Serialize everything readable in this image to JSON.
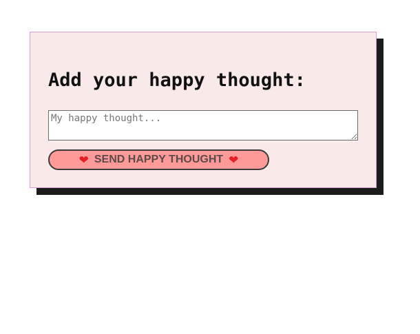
{
  "form": {
    "title": "Add your happy thought:",
    "input_placeholder": "My happy thought...",
    "input_value": "",
    "button_label": "SEND HAPPY THOUGHT",
    "button_icon": "heart-icon"
  },
  "colors": {
    "card_background": "#f9eae9",
    "card_border": "#d49fd6",
    "shadow": "#1c1c1c",
    "button_background": "#ff9a98",
    "heart": "#e61e25"
  }
}
